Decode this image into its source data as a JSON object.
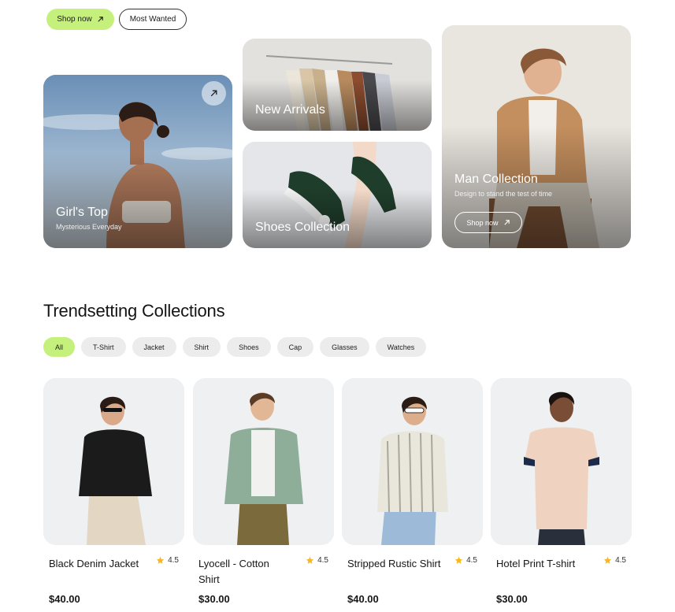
{
  "top_buttons": {
    "shop_now": "Shop now",
    "most_wanted": "Most Wanted"
  },
  "hero": {
    "girls_top": {
      "title": "Girl's Top",
      "subtitle": "Mysterious Everyday"
    },
    "new_arrivals": {
      "title": "New Arrivals"
    },
    "shoes": {
      "title": "Shoes Collection"
    },
    "man": {
      "title": "Man Collection",
      "subtitle": "Design to stand the test of time",
      "button": "Shop now"
    }
  },
  "section": {
    "title": "Trendsetting Collections"
  },
  "filters": [
    "All",
    "T-Shirt",
    "Jacket",
    "Shirt",
    "Shoes",
    "Cap",
    "Glasses",
    "Watches"
  ],
  "products": [
    {
      "name": "Black Denim Jacket",
      "rating": "4.5",
      "price": "$40.00"
    },
    {
      "name": "Lyocell - Cotton Shirt",
      "rating": "4.5",
      "price": "$30.00"
    },
    {
      "name": "Stripped Rustic Shirt",
      "rating": "4.5",
      "price": "$40.00"
    },
    {
      "name": "Hotel Print T-shirt",
      "rating": "4.5",
      "price": "$30.00"
    }
  ],
  "colors": {
    "accent": "#c5f07c",
    "chip": "#ececec",
    "star": "#f5b921"
  },
  "icons": {
    "arrow": "arrow-up-right-icon",
    "star": "star-icon"
  }
}
